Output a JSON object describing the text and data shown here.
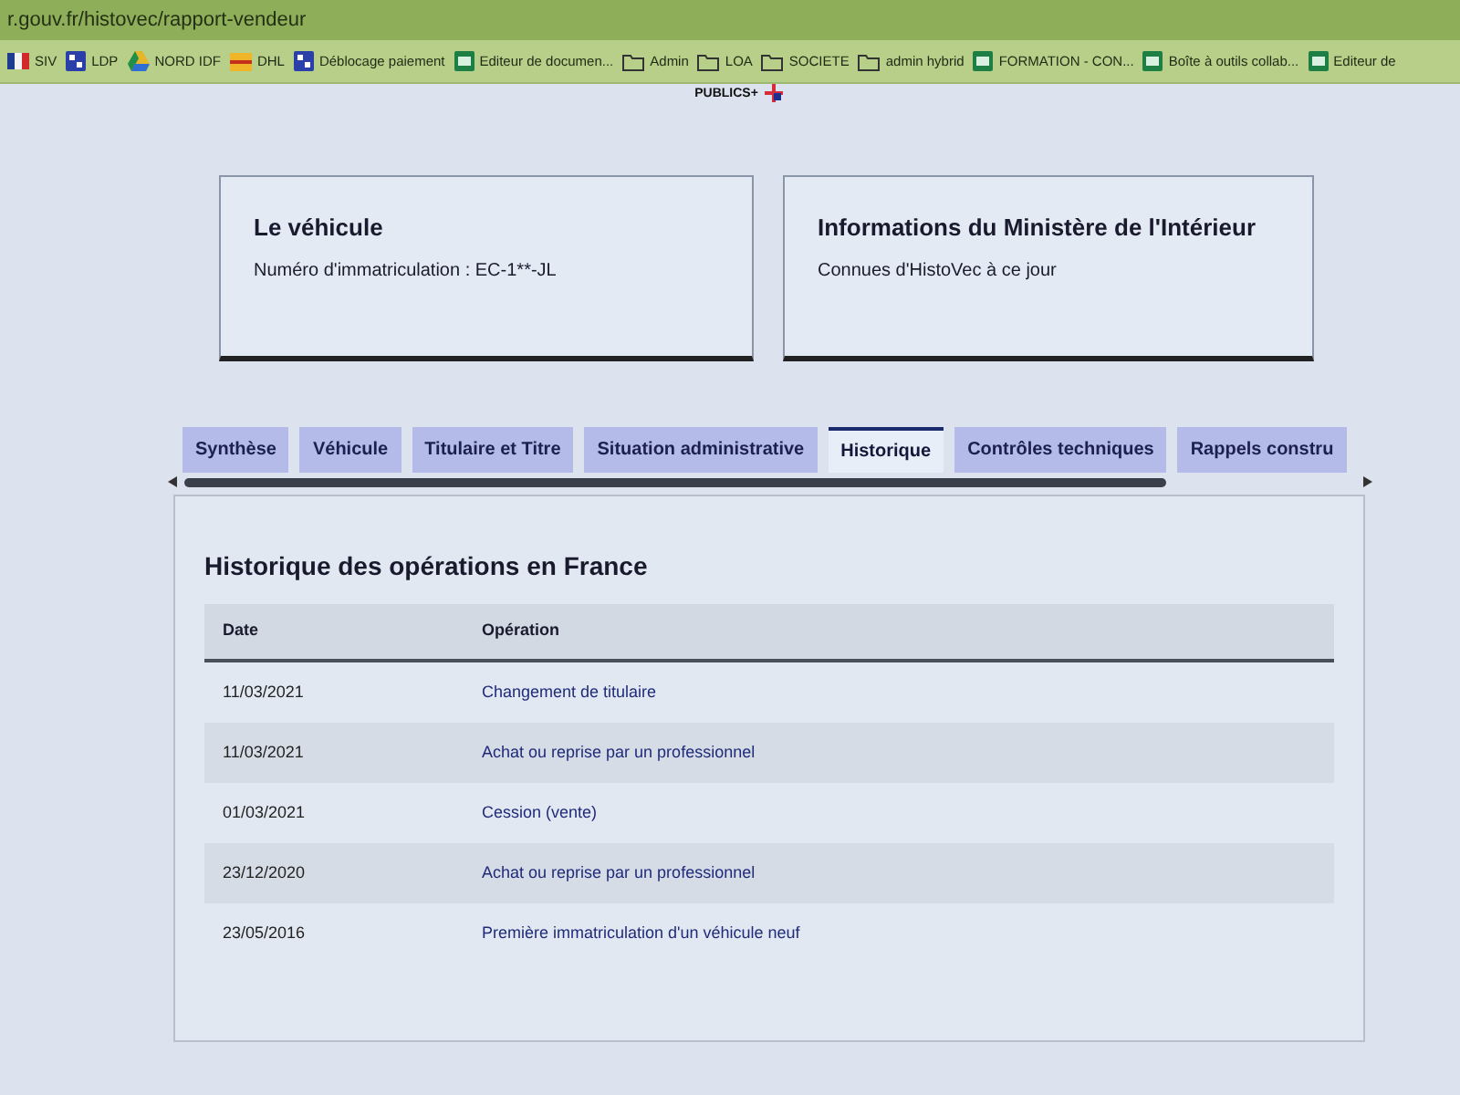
{
  "browser": {
    "url": "r.gouv.fr/histovec/rapport-vendeur",
    "bookmarks": [
      {
        "kind": "flag",
        "label": "SIV"
      },
      {
        "kind": "app",
        "label": "LDP"
      },
      {
        "kind": "drive",
        "label": "NORD IDF"
      },
      {
        "kind": "dhl",
        "label": "DHL"
      },
      {
        "kind": "app",
        "label": "Déblocage paiement"
      },
      {
        "kind": "sheet",
        "label": "Editeur de documen..."
      },
      {
        "kind": "folder",
        "label": "Admin"
      },
      {
        "kind": "folder",
        "label": "LOA"
      },
      {
        "kind": "folder",
        "label": "SOCIETE"
      },
      {
        "kind": "folder",
        "label": "admin hybrid"
      },
      {
        "kind": "sheet",
        "label": "FORMATION - CON..."
      },
      {
        "kind": "sheet",
        "label": "Boîte à outils collab..."
      },
      {
        "kind": "sheet",
        "label": "Editeur de"
      }
    ]
  },
  "logo": {
    "text": "PUBLICS+"
  },
  "cards": [
    {
      "title": "Le véhicule",
      "text": "Numéro d'immatriculation : EC-1**-JL"
    },
    {
      "title": "Informations du Ministère de l'Intérieur",
      "text": "Connues d'HistoVec à ce jour"
    }
  ],
  "tabs": [
    {
      "label": "Synthèse",
      "selected": false
    },
    {
      "label": "Véhicule",
      "selected": false
    },
    {
      "label": "Titulaire et Titre",
      "selected": false
    },
    {
      "label": "Situation administrative",
      "selected": false
    },
    {
      "label": "Historique",
      "selected": true
    },
    {
      "label": "Contrôles techniques",
      "selected": false
    },
    {
      "label": "Rappels constru",
      "selected": false
    }
  ],
  "panel": {
    "title": "Historique des opérations en France",
    "table": {
      "columns": [
        "Date",
        "Opération"
      ],
      "rows": [
        [
          "11/03/2021",
          "Changement de titulaire"
        ],
        [
          "11/03/2021",
          "Achat ou reprise par un professionnel"
        ],
        [
          "01/03/2021",
          "Cession (vente)"
        ],
        [
          "23/12/2020",
          "Achat ou reprise par un professionnel"
        ],
        [
          "23/05/2016",
          "Première immatriculation d'un véhicule neuf"
        ]
      ]
    }
  }
}
